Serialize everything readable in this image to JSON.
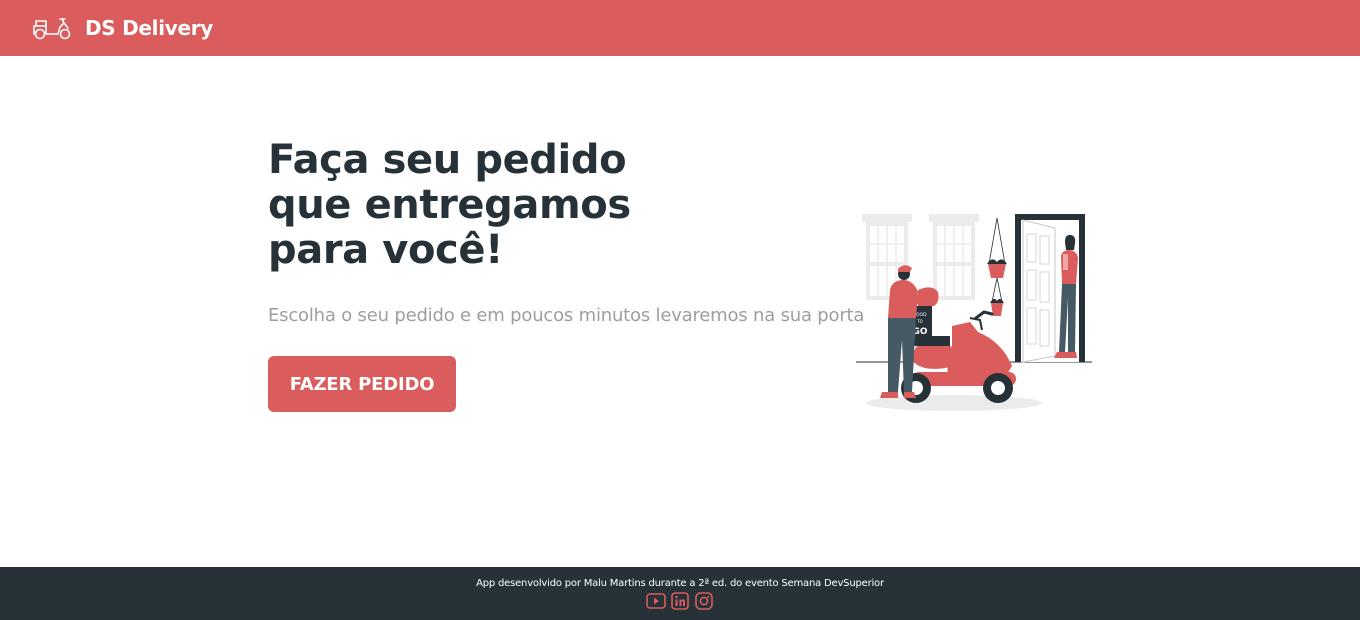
{
  "navbar": {
    "logo_icon": "scooter-icon",
    "title": "DS Delivery"
  },
  "hero": {
    "title_lines": [
      "Faça seu pedido",
      "que entregamos",
      "para você!"
    ],
    "subtitle": "Escolha o seu pedido e em poucos minutos levaremos na sua porta",
    "button_label": "FAZER PEDIDO",
    "illustration": {
      "box_text_top": "FOOD",
      "box_text_mid": "TO",
      "box_text_bottom": "GO"
    }
  },
  "footer": {
    "text": "App desenvolvido por Malu Martins durante a 2ª ed. do evento Semana DevSuperior",
    "social": [
      "youtube-icon",
      "linkedin-icon",
      "instagram-icon"
    ]
  },
  "colors": {
    "primary": "#DA5C5C",
    "dark": "#263238",
    "muted": "#9E9E9E"
  }
}
